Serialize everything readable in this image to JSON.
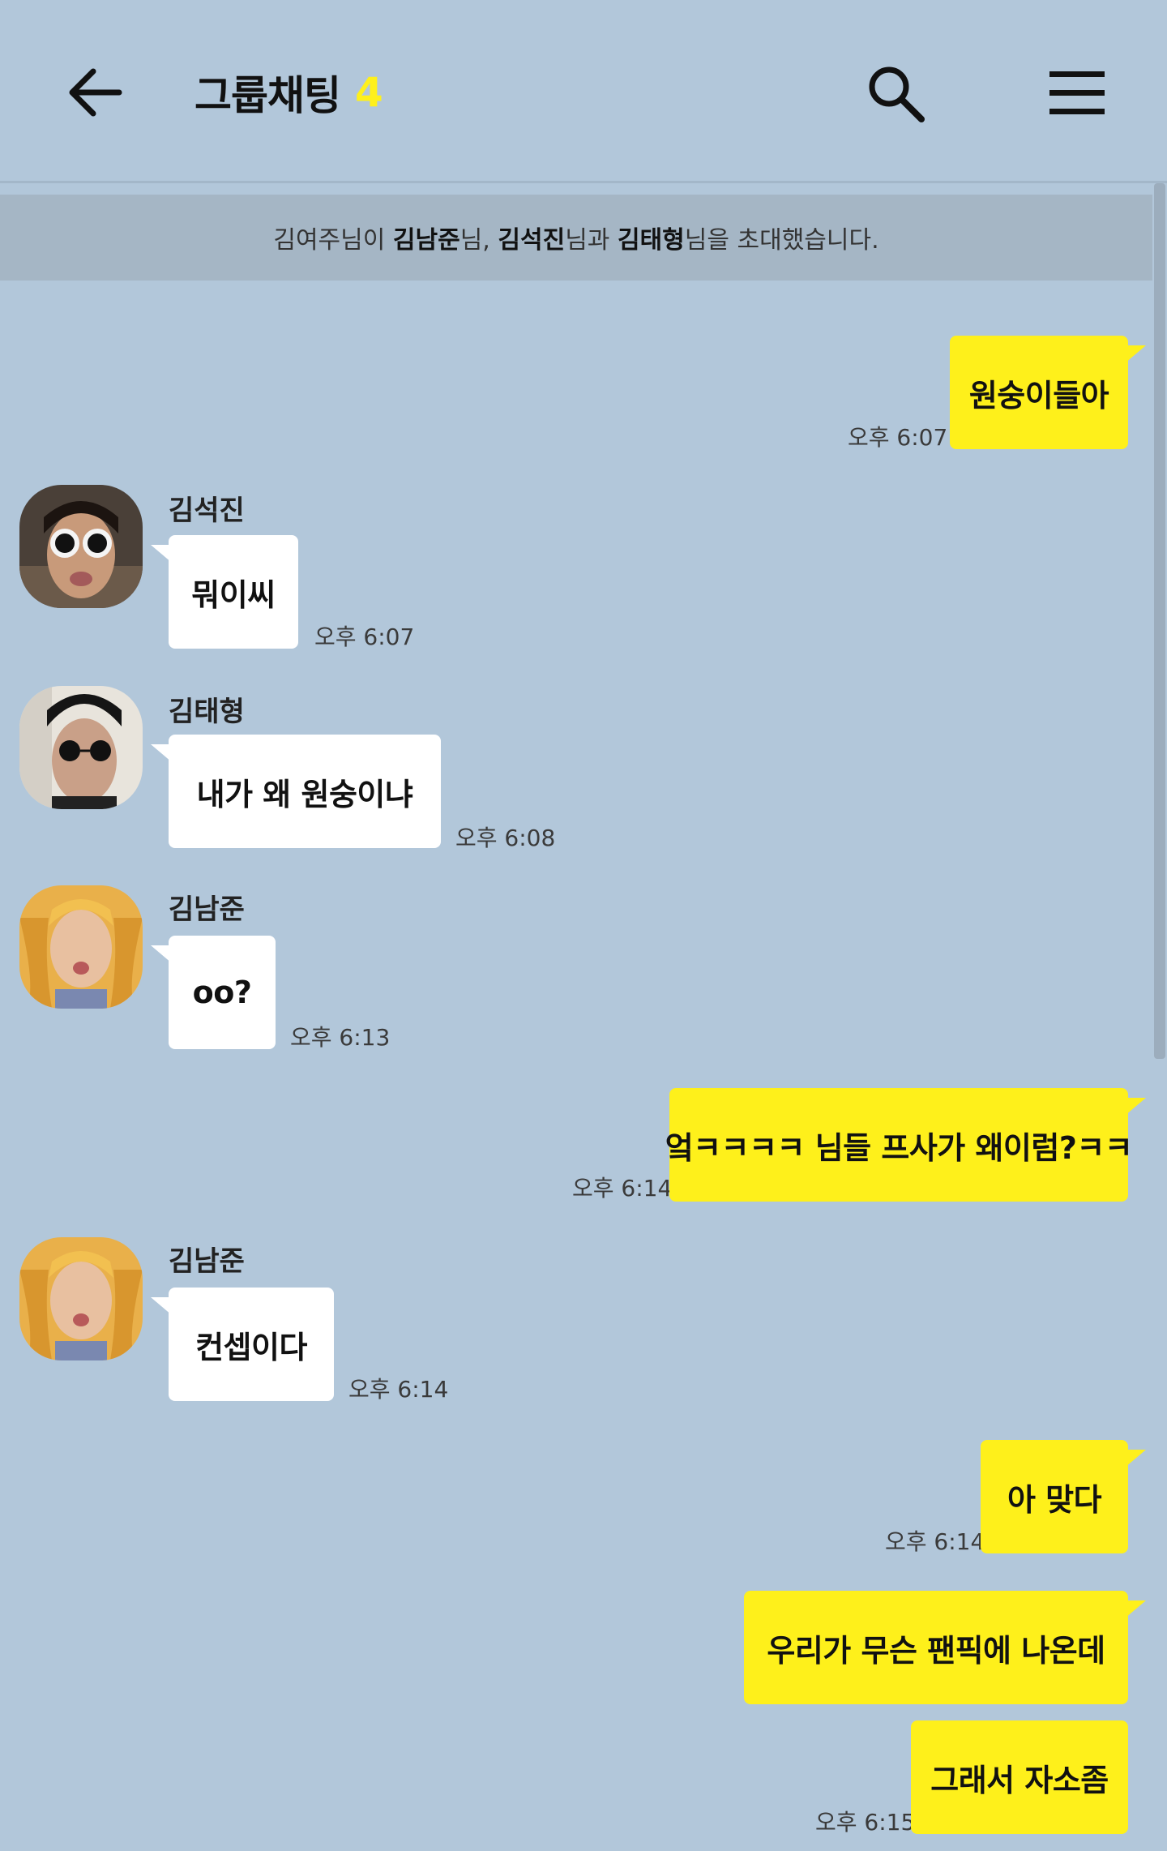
{
  "header": {
    "title": "그룹채팅",
    "member_count": "4"
  },
  "notice": {
    "inviter": "김여주님이",
    "name1": "김남준",
    "sep1": "님,",
    "name2": "김석진",
    "sep2": "님과",
    "name3": "김태형",
    "tail": "님을 초대했습니다."
  },
  "messages": [
    {
      "sender": "",
      "text": "원숭이들아",
      "time": "오후 6:07"
    },
    {
      "sender": "김석진",
      "text": "뭐이씨",
      "time": "오후 6:07"
    },
    {
      "sender": "김태형",
      "text": "내가 왜 원숭이냐",
      "time": "오후 6:08"
    },
    {
      "sender": "김남준",
      "text": "oo?",
      "time": "오후 6:13"
    },
    {
      "sender": "",
      "text": "엌ㅋㅋㅋㅋ 님들 프사가 왜이럼?ㅋㅋ",
      "time": "오후 6:14"
    },
    {
      "sender": "김남준",
      "text": "컨셉이다",
      "time": "오후 6:14"
    },
    {
      "sender": "",
      "text": "아 맞다",
      "time": "오후 6:14"
    },
    {
      "sender": "",
      "text": "우리가 무슨 팬픽에 나온데",
      "time": ""
    },
    {
      "sender": "",
      "text": "그래서 자소좀",
      "time": "오후 6:15"
    }
  ],
  "colors": {
    "background": "#b2c7da",
    "my_bubble": "#fef01b",
    "their_bubble": "#ffffff",
    "notice_bar": "#a5b6c5"
  },
  "icons": {
    "back": "arrow-left-icon",
    "search": "search-icon",
    "menu": "hamburger-menu-icon"
  }
}
